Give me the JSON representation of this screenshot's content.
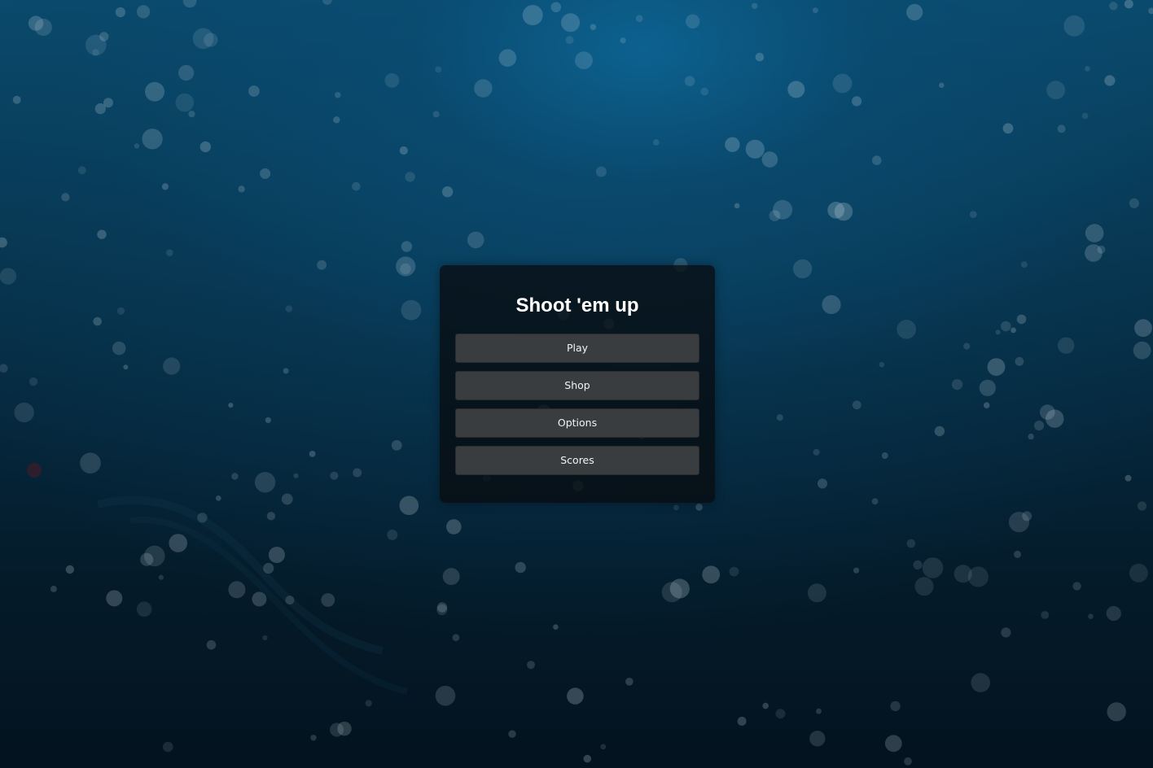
{
  "game": {
    "title": "Shoot 'em up"
  },
  "menu": {
    "play_label": "Play",
    "shop_label": "Shop",
    "options_label": "Options",
    "scores_label": "Scores"
  },
  "colors": {
    "background_top": "#0a4a6d",
    "background_bottom": "#03131f",
    "panel": "#080c10",
    "button": "#3a3d40",
    "text": "#ffffff"
  }
}
